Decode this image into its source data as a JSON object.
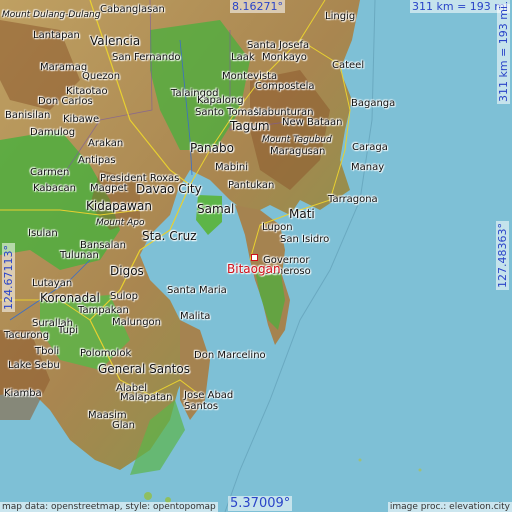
{
  "map": {
    "highlight_place": "Bitaogan",
    "lat_top": "8.16271°",
    "lat_bottom": "5.37009°",
    "lon_left": "124.67113°",
    "lon_right": "127.48363°",
    "scale_top": "311 km = 193 mi",
    "scale_right": "311 km = 193 mi",
    "credit_left": "map data: openstreetmap, style: opentopomap",
    "credit_right": "image proc.: elevation.city",
    "colors": {
      "water": "#7ec0d6",
      "lowland": "#4fae3e",
      "hills": "#c9b06a",
      "mountains": "#8c5a2e",
      "accent": "#d0101a",
      "coord": "#2a44c8"
    }
  },
  "places": [
    {
      "name": "Cabanglasan"
    },
    {
      "name": "Lingig"
    },
    {
      "name": "Mount Dulang-Dulang"
    },
    {
      "name": "Santa Josefa"
    },
    {
      "name": "Lantapan"
    },
    {
      "name": "Valencia"
    },
    {
      "name": "San Fernando"
    },
    {
      "name": "Laak"
    },
    {
      "name": "Monkayo"
    },
    {
      "name": "Cateel"
    },
    {
      "name": "Maramag"
    },
    {
      "name": "Quezon"
    },
    {
      "name": "Montevista"
    },
    {
      "name": "Kitaotao"
    },
    {
      "name": "Compostela"
    },
    {
      "name": "Baganga"
    },
    {
      "name": "Don Carlos"
    },
    {
      "name": "Talaingod"
    },
    {
      "name": "Kapalong"
    },
    {
      "name": "Nabunturan"
    },
    {
      "name": "Kibawe"
    },
    {
      "name": "Santo Tomas"
    },
    {
      "name": "New Bataan"
    },
    {
      "name": "Banisilan"
    },
    {
      "name": "Tagum"
    },
    {
      "name": "Mount Tagubud"
    },
    {
      "name": "Damulog"
    },
    {
      "name": "Arakan"
    },
    {
      "name": "Maragusan"
    },
    {
      "name": "Caraga"
    },
    {
      "name": "Panabo"
    },
    {
      "name": "Antipas"
    },
    {
      "name": "Mabini"
    },
    {
      "name": "Manay"
    },
    {
      "name": "Carmen"
    },
    {
      "name": "President Roxas"
    },
    {
      "name": "Kabacan"
    },
    {
      "name": "Magpet"
    },
    {
      "name": "Davao City"
    },
    {
      "name": "Pantukan"
    },
    {
      "name": "Samal"
    },
    {
      "name": "Tarragona"
    },
    {
      "name": "Kidapawan"
    },
    {
      "name": "Mati"
    },
    {
      "name": "Mount Apo"
    },
    {
      "name": "Lupon"
    },
    {
      "name": "San Isidro"
    },
    {
      "name": "Sta. Cruz"
    },
    {
      "name": "Bansalan"
    },
    {
      "name": "Governor Generoso"
    },
    {
      "name": "Tulunan"
    },
    {
      "name": "Digos"
    },
    {
      "name": "Lutayan"
    },
    {
      "name": "Santa Maria"
    },
    {
      "name": "Koronadal"
    },
    {
      "name": "Sulop"
    },
    {
      "name": "Malita"
    },
    {
      "name": "Tampakan"
    },
    {
      "name": "Surallah"
    },
    {
      "name": "Malungon"
    },
    {
      "name": "Tupi"
    },
    {
      "name": "Don Marcelino"
    },
    {
      "name": "Tboli"
    },
    {
      "name": "Polomolok"
    },
    {
      "name": "General Santos"
    },
    {
      "name": "Lake Sebu"
    },
    {
      "name": "Alabel"
    },
    {
      "name": "Jose Abad Santos"
    },
    {
      "name": "Kiamba"
    },
    {
      "name": "Malapatan"
    },
    {
      "name": "Maasim"
    },
    {
      "name": "Glan"
    },
    {
      "name": "Isulan"
    },
    {
      "name": "Tacurong"
    },
    {
      "name": "Samal"
    }
  ]
}
